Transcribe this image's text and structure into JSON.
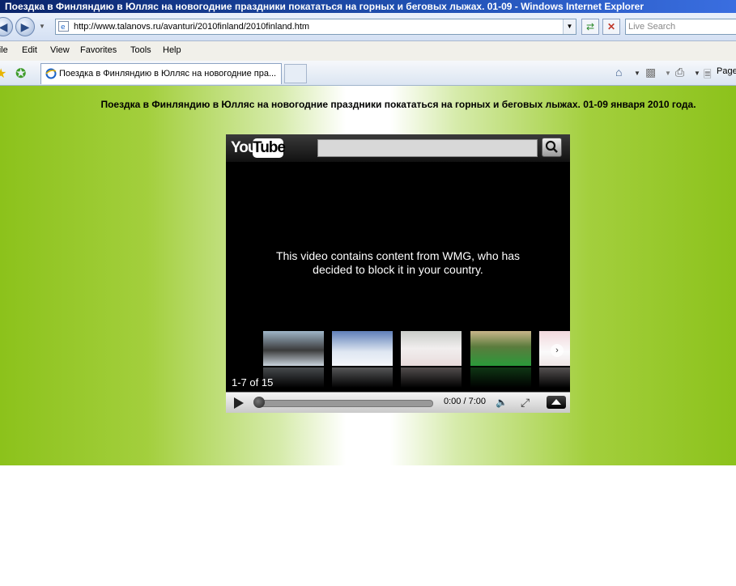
{
  "window": {
    "title": "Поездка в Финляндию в Юлляс на новогодние праздники покататься на горных и беговых лыжах. 01-09 - Windows Internet Explorer"
  },
  "address_bar": {
    "url": "http://www.talanovs.ru/avanturi/2010finland/2010finland.htm",
    "search_placeholder": "Live Search"
  },
  "menu": {
    "items": [
      "File",
      "Edit",
      "View",
      "Favorites",
      "Tools",
      "Help"
    ]
  },
  "tab": {
    "label": "Поездка в Финляндию в Юлляс на новогодние пра..."
  },
  "toolbar": {
    "page_label": "Page"
  },
  "page": {
    "heading": "Поездка в Финляндию в Юлляс на новогодние праздники покататься на горных и беговых лыжах. 01-09 января 2010 года."
  },
  "player": {
    "logo_you": "You",
    "logo_tube": "Tube",
    "blocked_message_line1": "This video contains content from WMG, who has",
    "blocked_message_line2": "decided to block it in your country.",
    "playlist_count": "1-7 of 15",
    "time": "0:00 / 7:00",
    "progress": 0.0
  },
  "colors": {
    "page_green": "#8cc21b",
    "titlebar_blue": "#0a246a"
  }
}
